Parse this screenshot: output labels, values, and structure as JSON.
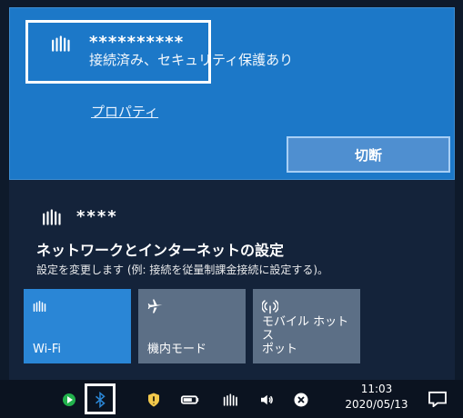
{
  "connected_network": {
    "name": "**********",
    "status": "接続済み、セキュリティ保護あり",
    "properties_link": "プロパティ",
    "disconnect_label": "切断"
  },
  "other_network": {
    "name": "****"
  },
  "settings": {
    "title": "ネットワークとインターネットの設定",
    "description": "設定を変更します (例: 接続を従量制課金接続に設定する)。"
  },
  "quick_actions": [
    {
      "label": "Wi-Fi",
      "icon": "wifi-icon",
      "active": true
    },
    {
      "label": "機内モード",
      "icon": "airplane-icon",
      "active": false
    },
    {
      "label": "モバイル ホットス\nポット",
      "icon": "hotspot-icon",
      "active": false
    }
  ],
  "taskbar": {
    "time": "11:03",
    "date": "2020/05/13",
    "icons": [
      "app-icon",
      "bluetooth-icon",
      "security-icon",
      "battery-icon",
      "wifi-icon",
      "volume-icon",
      "close-icon",
      "notification-icon"
    ]
  }
}
